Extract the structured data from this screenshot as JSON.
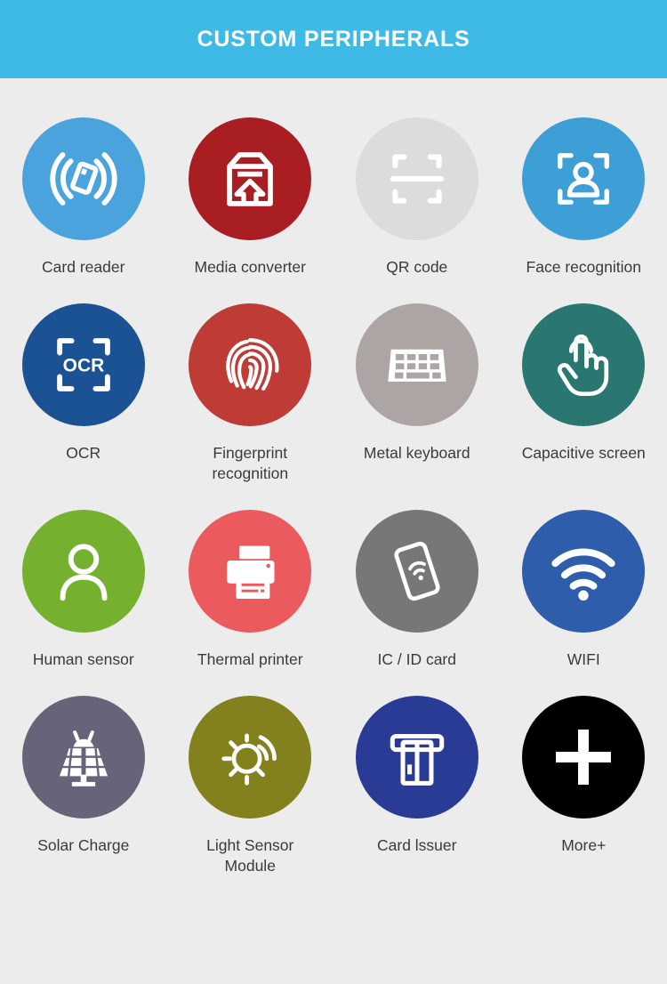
{
  "header": {
    "title": "CUSTOM PERIPHERALS",
    "background_color": "#3fb9e5",
    "text_color": "#ffffff"
  },
  "page": {
    "background_color": "#ececec",
    "label_color": "#3a3a3a",
    "columns": 4,
    "rows": 4
  },
  "items": [
    {
      "label": "Card reader",
      "icon": "rfid-card-reader-icon",
      "color": "#4aa3dc"
    },
    {
      "label": "Media converter",
      "icon": "media-converter-icon",
      "color": "#a81e23"
    },
    {
      "label": "QR code",
      "icon": "qr-scan-icon",
      "color": "#dcdcdc"
    },
    {
      "label": "Face recognition",
      "icon": "face-recognition-icon",
      "color": "#3e9fd6"
    },
    {
      "label": "OCR",
      "icon": "ocr-icon",
      "color": "#1b5293"
    },
    {
      "label": "Fingerprint\nrecognition",
      "icon": "fingerprint-icon",
      "color": "#be3b36"
    },
    {
      "label": "Metal keyboard",
      "icon": "keyboard-icon",
      "color": "#ada5a3"
    },
    {
      "label": "Capacitive screen",
      "icon": "touch-hand-icon",
      "color": "#2a7771"
    },
    {
      "label": "Human sensor",
      "icon": "person-icon",
      "color": "#76b02f"
    },
    {
      "label": "Thermal printer",
      "icon": "printer-icon",
      "color": "#eb5a5c"
    },
    {
      "label": "IC / ID card",
      "icon": "nfc-card-icon",
      "color": "#777777"
    },
    {
      "label": "WIFI",
      "icon": "wifi-icon",
      "color": "#2e5eab"
    },
    {
      "label": "Solar Charge",
      "icon": "solar-panel-icon",
      "color": "#676379"
    },
    {
      "label": "Light Sensor\nModule",
      "icon": "light-sensor-icon",
      "color": "#82811e"
    },
    {
      "label": "Card lssuer",
      "icon": "card-issuer-icon",
      "color": "#293b94"
    },
    {
      "label": "More+",
      "icon": "plus-icon",
      "color": "#000000"
    }
  ],
  "ocr_glyph_text": "OCR"
}
